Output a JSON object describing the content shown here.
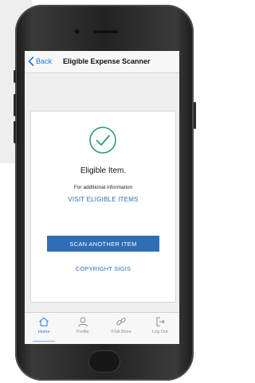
{
  "navbar": {
    "back_label": "Back",
    "title": "Eligible Expense Scanner"
  },
  "result": {
    "status": "Eligible Item.",
    "info": "For additional information",
    "visit_link": "VISIT ELIGIBLE ITEMS",
    "scan_button": "SCAN ANOTHER ITEM",
    "copyright_link": "COPYRIGHT SIGIS"
  },
  "tabs": [
    {
      "label": "Home",
      "icon": "home-icon",
      "active": true
    },
    {
      "label": "Profile",
      "icon": "profile-icon",
      "active": false
    },
    {
      "label": "FSA Store",
      "icon": "link-icon",
      "active": false
    },
    {
      "label": "Log Out",
      "icon": "logout-icon",
      "active": false
    }
  ],
  "colors": {
    "accent": "#1f7ae0",
    "button": "#2f6db5",
    "check": "#2e9f6a"
  }
}
